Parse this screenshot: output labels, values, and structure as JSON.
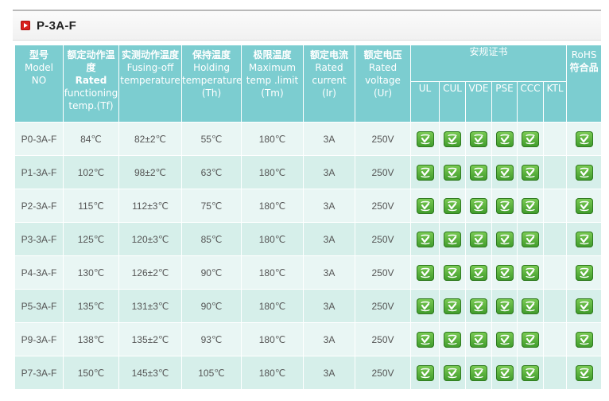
{
  "title": "P-3A-F",
  "headers": {
    "model": {
      "zh": "型号",
      "en1": "Model",
      "en2": "NO"
    },
    "rated_temp": {
      "zh": "额定动作温度",
      "en_bold": "Rated",
      "en1": "functioning",
      "en2": "temp.(Tf)"
    },
    "fusing_temp": {
      "zh": "实测动作温度",
      "en1": "Fusing-off",
      "en2": "temperature"
    },
    "holding_temp": {
      "zh": "保持温度",
      "en1": "Holding",
      "en2": "temperature",
      "en3": "(Th)"
    },
    "max_temp": {
      "zh": "极限温度",
      "en1": "Maximum",
      "en2": "temp .limit",
      "en3": "(Tm)"
    },
    "rated_current": {
      "zh": "额定电流",
      "en1": "Rated",
      "en2": "current",
      "en3": "(Ir)"
    },
    "rated_voltage": {
      "zh": "额定电压",
      "en1": "Rated",
      "en2": "voltage",
      "en3": "(Ur)"
    },
    "certs_group": "安规证书",
    "certs": [
      "UL",
      "CUL",
      "VDE",
      "PSE",
      "CCC",
      "KTL"
    ],
    "rohs": {
      "en": "RoHS",
      "zh": "符合品"
    }
  },
  "rows": [
    {
      "model": "P0-3A-F",
      "tf": "84℃",
      "fusing": "82±2℃",
      "th": "55℃",
      "tm": "180℃",
      "ir": "3A",
      "ur": "250V",
      "certs": [
        true,
        true,
        true,
        true,
        true,
        false
      ],
      "rohs": true
    },
    {
      "model": "P1-3A-F",
      "tf": "102℃",
      "fusing": "98±2℃",
      "th": "63℃",
      "tm": "180℃",
      "ir": "3A",
      "ur": "250V",
      "certs": [
        true,
        true,
        true,
        true,
        true,
        false
      ],
      "rohs": true
    },
    {
      "model": "P2-3A-F",
      "tf": "115℃",
      "fusing": "112±3℃",
      "th": "75℃",
      "tm": "180℃",
      "ir": "3A",
      "ur": "250V",
      "certs": [
        true,
        true,
        true,
        true,
        true,
        false
      ],
      "rohs": true
    },
    {
      "model": "P3-3A-F",
      "tf": "125℃",
      "fusing": "120±3℃",
      "th": "85℃",
      "tm": "180℃",
      "ir": "3A",
      "ur": "250V",
      "certs": [
        true,
        true,
        true,
        true,
        true,
        false
      ],
      "rohs": true
    },
    {
      "model": "P4-3A-F",
      "tf": "130℃",
      "fusing": "126±2℃",
      "th": "90℃",
      "tm": "180℃",
      "ir": "3A",
      "ur": "250V",
      "certs": [
        true,
        true,
        true,
        true,
        true,
        false
      ],
      "rohs": true
    },
    {
      "model": "P5-3A-F",
      "tf": "135℃",
      "fusing": "131±3℃",
      "th": "90℃",
      "tm": "180℃",
      "ir": "3A",
      "ur": "250V",
      "certs": [
        true,
        true,
        true,
        true,
        true,
        false
      ],
      "rohs": true
    },
    {
      "model": "P9-3A-F",
      "tf": "138℃",
      "fusing": "135±2℃",
      "th": "93℃",
      "tm": "180℃",
      "ir": "3A",
      "ur": "250V",
      "certs": [
        true,
        true,
        true,
        true,
        true,
        false
      ],
      "rohs": true
    },
    {
      "model": "P7-3A-F",
      "tf": "150℃",
      "fusing": "145±3℃",
      "th": "105℃",
      "tm": "180℃",
      "ir": "3A",
      "ur": "250V",
      "certs": [
        true,
        true,
        true,
        true,
        true,
        false
      ],
      "rohs": true
    }
  ],
  "colors": {
    "header_bg": "#7ccdd0",
    "row_odd": "#e9f6f4",
    "row_even": "#d6efea",
    "cert_icon": "#4aa832",
    "title_icon": "#d9211d"
  },
  "icons": {
    "title": "play-square-icon",
    "cert": "certified-check-icon"
  }
}
